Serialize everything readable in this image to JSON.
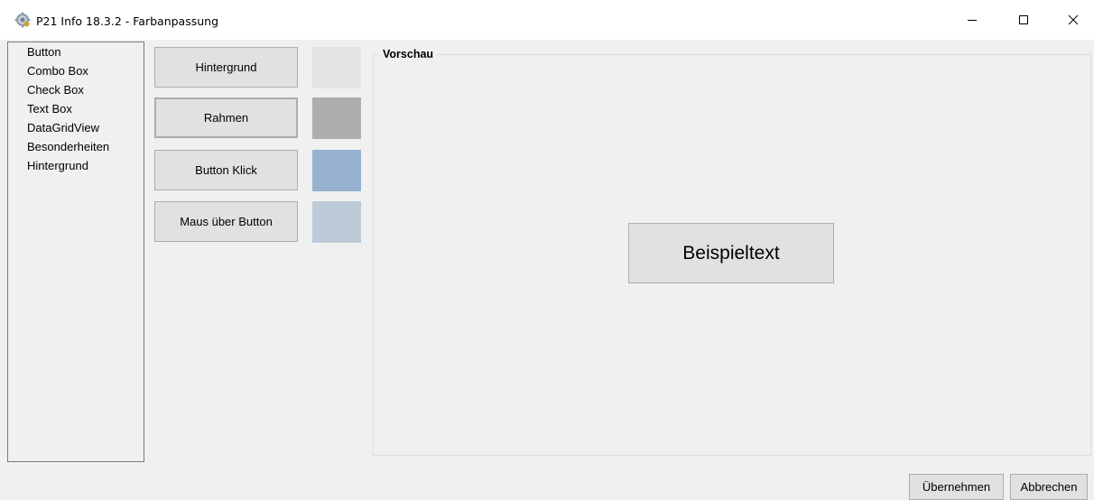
{
  "window": {
    "title": "P21 Info 18.3.2 - Farbanpassung",
    "icon": "gear-icon",
    "controls": {
      "minimize": "minimize-icon",
      "maximize": "maximize-icon",
      "close": "close-icon"
    }
  },
  "sidebar": {
    "items": [
      {
        "label": "Button"
      },
      {
        "label": "Combo Box"
      },
      {
        "label": "Check Box"
      },
      {
        "label": "Text Box"
      },
      {
        "label": "DataGridView"
      },
      {
        "label": "Besonderheiten"
      },
      {
        "label": "Hintergrund"
      }
    ]
  },
  "color_settings": [
    {
      "label": "Hintergrund",
      "swatch": "#e3e3e3"
    },
    {
      "label": "Rahmen",
      "swatch": "#adadad"
    },
    {
      "label": "Button Klick",
      "swatch": "#97b1d0"
    },
    {
      "label": "Maus über Button",
      "swatch": "#bdcbd9"
    }
  ],
  "preview": {
    "group_title": "Vorschau",
    "sample_text": "Beispieltext"
  },
  "footer": {
    "apply_label": "Übernehmen",
    "cancel_label": "Abbrechen"
  }
}
